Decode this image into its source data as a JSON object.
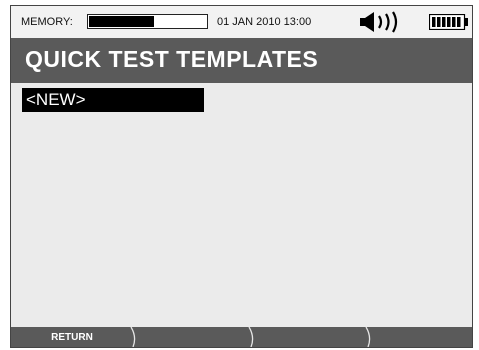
{
  "status": {
    "memory_label": "MEMORY:",
    "memory_used": 0.55,
    "datetime": "01 JAN 2010 13:00",
    "speaker_icon": "speaker-volume-icon",
    "battery_icon": "battery-full-icon"
  },
  "header": {
    "title": "QUICK TEST TEMPLATES"
  },
  "list": {
    "items": [
      {
        "label": "<NEW>",
        "selected": true
      }
    ]
  },
  "softkeys": [
    {
      "label": "RETURN"
    },
    {
      "label": ""
    },
    {
      "label": ""
    },
    {
      "label": ""
    }
  ],
  "colors": {
    "title_bar": "#5a5a5a",
    "screen_bg": "#ebebeb",
    "softkey_bar": "#5a5a5a",
    "selection": "#000000"
  }
}
